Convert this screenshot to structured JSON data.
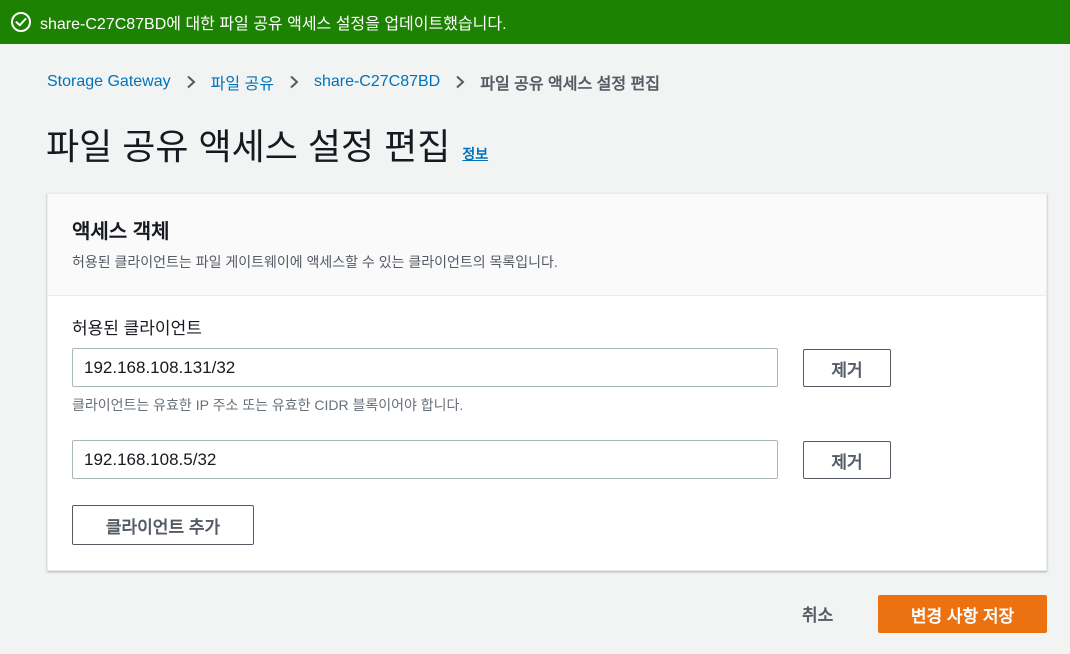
{
  "flash": {
    "message": "share-C27C87BD에 대한 파일 공유 액세스 설정을 업데이트했습니다.",
    "icon": "check-circle-icon",
    "color": "#1d8102"
  },
  "breadcrumb": {
    "items": [
      "Storage Gateway",
      "파일 공유",
      "share-C27C87BD"
    ],
    "current": "파일 공유 액세스 설정 편집"
  },
  "page": {
    "title": "파일 공유 액세스 설정 편집",
    "info_link": "정보"
  },
  "panel": {
    "title": "액세스 객체",
    "description": "허용된 클라이언트는 파일 게이트웨이에 액세스할 수 있는 클라이언트의 목록입니다.",
    "field_label": "허용된 클라이언트",
    "field_description": "클라이언트는 유효한 IP 주소 또는 유효한 CIDR 블록이어야 합니다.",
    "clients": [
      {
        "value": "192.168.108.131/32",
        "remove_label": "제거"
      },
      {
        "value": "192.168.108.5/32",
        "remove_label": "제거"
      }
    ],
    "add_client_label": "클라이언트 추가"
  },
  "actions": {
    "cancel_label": "취소",
    "save_label": "변경 사항 저장",
    "primary_color": "#ec7211"
  }
}
